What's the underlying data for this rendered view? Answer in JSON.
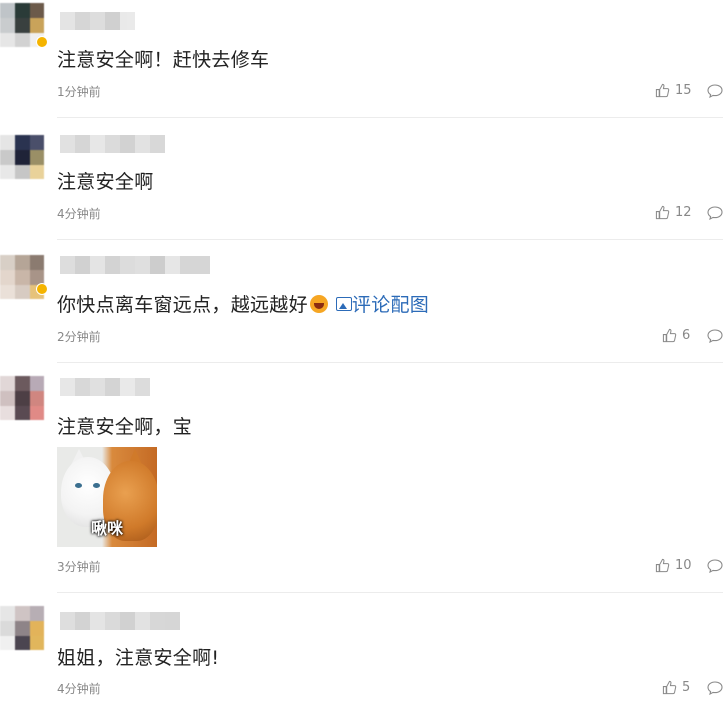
{
  "comments": [
    {
      "text": "注意安全啊！赶快去修车",
      "time": "1分钟前",
      "likes": "15",
      "avatar_colors": [
        "#bfc4c8",
        "#2a3b38",
        "#6c5a4a",
        "#c9ccce",
        "#39403f",
        "#c9a35a",
        "#e6e6e6",
        "#d2d2d2",
        "#f0f0f0"
      ],
      "name_colors": [
        "#e0e0e0",
        "#cfcfcf",
        "#d8d8d8",
        "#c8c8c8",
        "#e6e6e6"
      ]
    },
    {
      "text": "注意安全啊",
      "time": "4分钟前",
      "likes": "12",
      "avatar_colors": [
        "#e5e5e5",
        "#2a3350",
        "#4a4f6a",
        "#c9c9c9",
        "#1f2338",
        "#9a8f66",
        "#e8e8e8",
        "#c6c6c6",
        "#e9d29a"
      ],
      "name_colors": [
        "#dcdcdc",
        "#cfcfcf",
        "#e3e3e3",
        "#d5d5d5",
        "#cbcbcb",
        "#dedede",
        "#d2d2d2"
      ]
    },
    {
      "text_main": "你快点离车窗远点，越远越好",
      "link": "评论配图",
      "time": "2分钟前",
      "likes": "6",
      "avatar_colors": [
        "#d8cfc6",
        "#b5a597",
        "#8b7b70",
        "#e3d6cc",
        "#c9b6a8",
        "#a89488",
        "#eae0d8",
        "#d7cbc2",
        "#e6c27a"
      ],
      "name_colors": [
        "#d8d8d8",
        "#c9c9c9",
        "#e0e0e0",
        "#cccccc",
        "#d6d6d6",
        "#dadada",
        "#c5c5c5",
        "#e2e2e2",
        "#d0d0d0",
        "#cfcfcf"
      ]
    },
    {
      "text": "注意安全啊，宝",
      "time": "3分钟前",
      "likes": "10",
      "image_caption": "啾咪",
      "avatar_colors": [
        "#e1d7d7",
        "#6c5a5e",
        "#b8aab6",
        "#cfc0c0",
        "#4d3f45",
        "#d08680",
        "#e8dede",
        "#5a4a52",
        "#e08a86"
      ],
      "name_colors": [
        "#e3e3e3",
        "#d2d2d2",
        "#dbdbdb",
        "#cdcdcd",
        "#e6e6e6",
        "#d7d7d7"
      ]
    },
    {
      "text": "姐姐，注意安全啊!",
      "time": "4分钟前",
      "likes": "5",
      "avatar_colors": [
        "#e6e6e6",
        "#cfc4c4",
        "#b7aeb4",
        "#dadada",
        "#8e8488",
        "#e2b35a",
        "#f0f0f0",
        "#4b4550",
        "#e1b65c"
      ],
      "name_colors": [
        "#d9d9d9",
        "#cccccc",
        "#e0e0e0",
        "#d4d4d4",
        "#c9c9c9",
        "#dddddd",
        "#d1d1d1",
        "#cfcfcf"
      ]
    }
  ]
}
